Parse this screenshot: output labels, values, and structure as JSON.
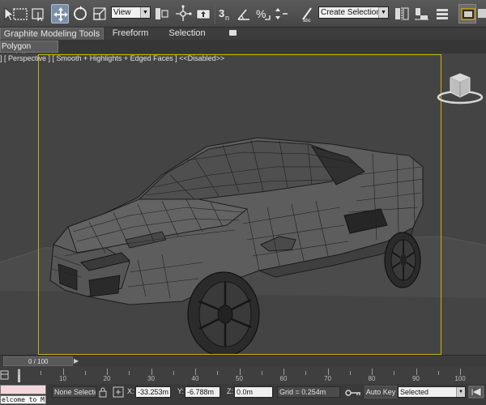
{
  "toolbar": {
    "reference_dropdown": "View",
    "named_selection": "Create Selection Se",
    "angle_snap_label": "3",
    "snap_sub": "n",
    "percent_snap_label": "%",
    "spinner_snap_label": "abc"
  },
  "ribbon": {
    "tabs": [
      "Graphite Modeling Tools",
      "Freeform",
      "Selection"
    ],
    "active_tab": 0,
    "panel_tab": "Polygon Modeling"
  },
  "viewport": {
    "label": "] [ Perspective ] [ Smooth + Highlights + Edged Faces ] <<Disabled>>",
    "border_color": "#c8b400",
    "background_color": "#444444",
    "wire_color": "#1a1a1a"
  },
  "time_slider": {
    "frame_text": "0 / 100",
    "current": 0,
    "total": 100
  },
  "trackbar": {
    "labels": [
      "10",
      "20",
      "30",
      "40",
      "50",
      "60",
      "70",
      "80",
      "90",
      "100"
    ]
  },
  "status": {
    "maxscript_text": "elcome to M",
    "selection_status": "None Selected",
    "x_label": "X:",
    "x_value": "-33.253m",
    "y_label": "Y:",
    "y_value": "-6.788m",
    "z_label": "Z:",
    "z_value": "0.0m",
    "grid_text": "Grid = 0.254m",
    "auto_key": "Auto Key",
    "key_mode": "Selected"
  },
  "icons": {
    "select": "select-arrow-icon",
    "region": "rect-region-icon",
    "move": "move-icon",
    "rotate": "rotate-icon",
    "scale": "scale-icon",
    "pivot": "pivot-icon",
    "manipulate": "manipulate-icon",
    "keyboard": "keyboard-icon",
    "snap": "snap-icon",
    "mirror": "mirror-icon",
    "align": "align-icon",
    "layer": "layer-icon",
    "render": "render-icon",
    "lock": "lock-icon",
    "key": "key-icon"
  }
}
